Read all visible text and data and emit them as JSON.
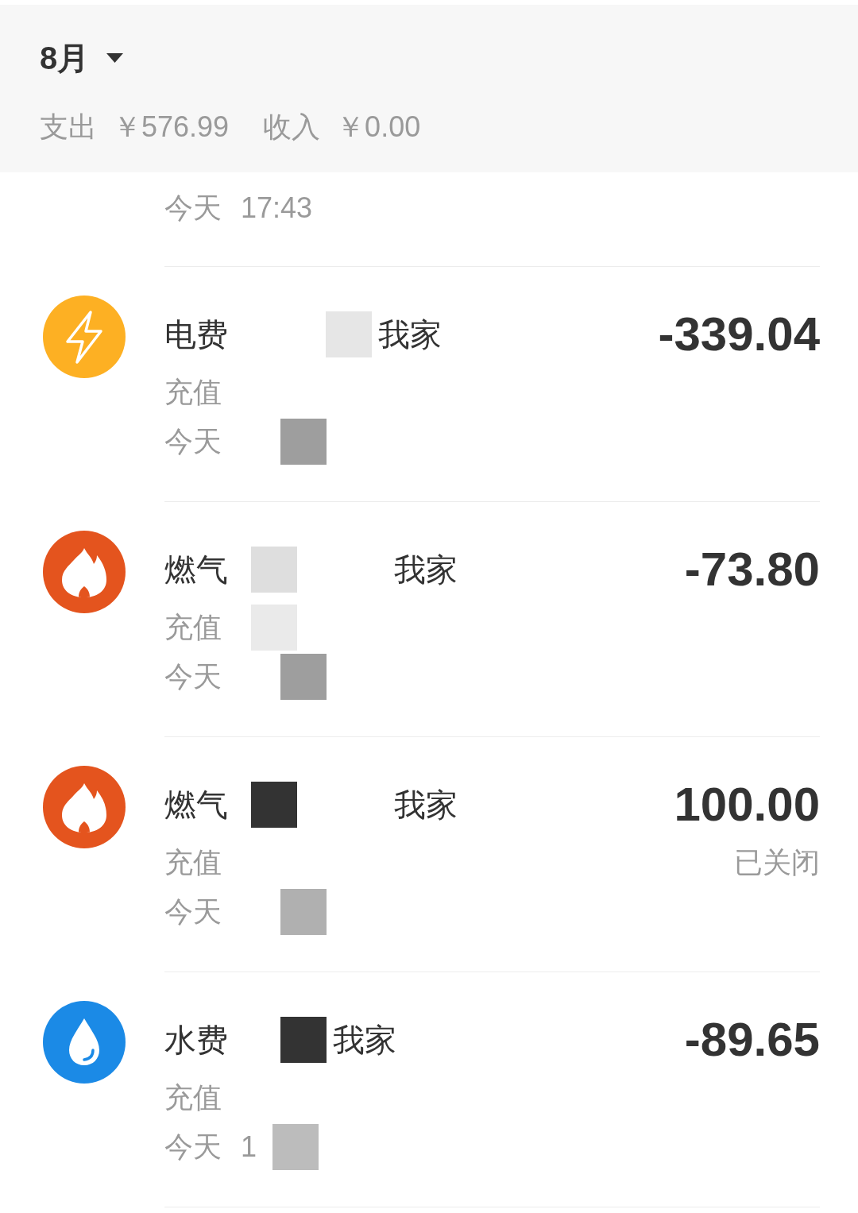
{
  "header": {
    "month": "8月",
    "stats": [
      {
        "label": "支出",
        "value": "￥576.99"
      },
      {
        "label": "收入",
        "value": "￥0.00"
      }
    ]
  },
  "partial_row": {
    "time": "今天 17:43"
  },
  "rows": [
    {
      "kind": "electricity",
      "color": "#fdb023",
      "title": [
        {
          "kind": "text",
          "text": "电费"
        },
        {
          "kind": "gap"
        },
        {
          "kind": "gap"
        },
        {
          "kind": "mask",
          "color": "#e6e6e6"
        },
        {
          "kind": "text",
          "text": "我家"
        }
      ],
      "subtitle": [
        {
          "kind": "text",
          "text": "充值"
        }
      ],
      "time": [
        {
          "kind": "text",
          "text": "今天"
        },
        {
          "kind": "gap"
        },
        {
          "kind": "mask",
          "color": "#9e9e9e"
        }
      ],
      "amount": "-339.04"
    },
    {
      "kind": "gas",
      "color": "#e4541e",
      "title": [
        {
          "kind": "text",
          "text": "燃气"
        },
        {
          "kind": "mask",
          "color": "#dedede"
        },
        {
          "kind": "gap"
        },
        {
          "kind": "gap"
        },
        {
          "kind": "text",
          "text": "我家"
        }
      ],
      "subtitle": [
        {
          "kind": "text",
          "text": "充值"
        },
        {
          "kind": "mask",
          "color": "#eaeaea"
        }
      ],
      "time": [
        {
          "kind": "text",
          "text": "今天"
        },
        {
          "kind": "gap"
        },
        {
          "kind": "mask",
          "color": "#9e9e9e"
        }
      ],
      "amount": "-73.80"
    },
    {
      "kind": "gas",
      "color": "#e4541e",
      "title": [
        {
          "kind": "text",
          "text": "燃气"
        },
        {
          "kind": "mask",
          "color": "#333333"
        },
        {
          "kind": "gap"
        },
        {
          "kind": "gap"
        },
        {
          "kind": "text",
          "text": "我家"
        }
      ],
      "subtitle": [
        {
          "kind": "text",
          "text": "充值"
        }
      ],
      "time": [
        {
          "kind": "text",
          "text": "今天"
        },
        {
          "kind": "gap"
        },
        {
          "kind": "mask",
          "color": "#b0b0b0"
        }
      ],
      "amount": "100.00",
      "status": "已关闭"
    },
    {
      "kind": "water",
      "color": "#1b8ae6",
      "title": [
        {
          "kind": "text",
          "text": "水费"
        },
        {
          "kind": "gap"
        },
        {
          "kind": "mask",
          "color": "#333333"
        },
        {
          "kind": "text",
          "text": "我家"
        }
      ],
      "subtitle": [
        {
          "kind": "text",
          "text": "充值"
        }
      ],
      "time": [
        {
          "kind": "text",
          "text": "今天 1"
        },
        {
          "kind": "mask",
          "color": "#bcbcbc"
        }
      ],
      "amount": "-89.65"
    }
  ]
}
